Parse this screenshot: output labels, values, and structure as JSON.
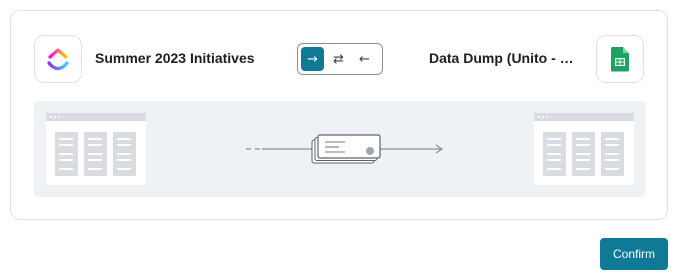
{
  "sync": {
    "left_app": {
      "name": "Summer 2023 Initiatives",
      "logo": "clickup-logo-icon"
    },
    "right_app": {
      "name": "Data Dump (Unito - ClickUp)",
      "logo": "google-sheets-logo-icon"
    },
    "direction_options": [
      {
        "symbol": "→",
        "icon": "arrow-right-icon",
        "selected": true
      },
      {
        "symbol": "⇄",
        "icon": "arrows-two-way-icon",
        "selected": false
      },
      {
        "symbol": "←",
        "icon": "arrow-left-icon",
        "selected": false
      }
    ]
  },
  "preview": {
    "direction": "left-to-right"
  },
  "footer": {
    "confirm_label": "Confirm"
  },
  "colors": {
    "accent": "#0e7a95",
    "preview_bg": "#eff2f5",
    "placeholder": "#d9dde2"
  }
}
